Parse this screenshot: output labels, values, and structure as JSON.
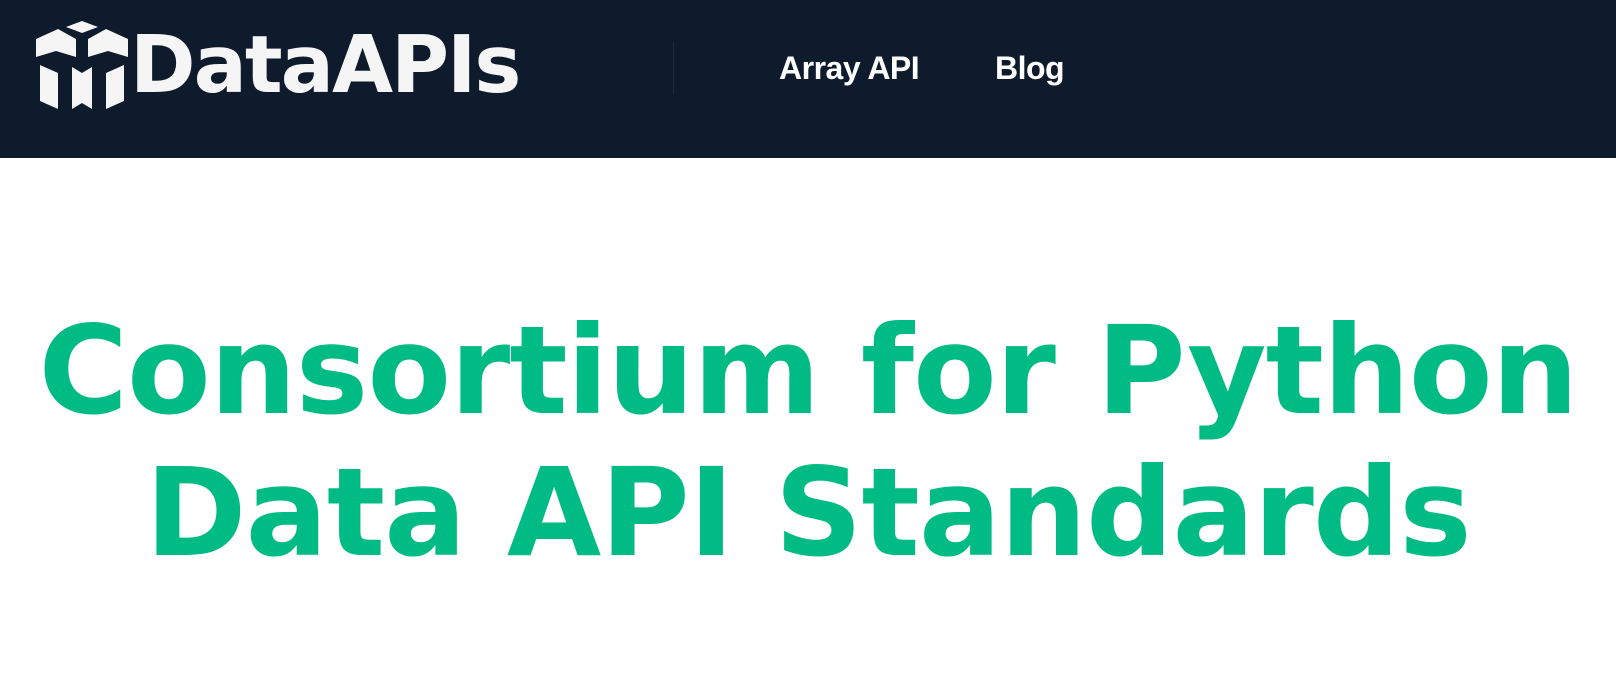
{
  "header": {
    "logo_text": "DataAPIs",
    "logo_icon": "data-apis-logo-icon",
    "nav_items": [
      {
        "label": "Array API"
      },
      {
        "label": "Blog"
      }
    ]
  },
  "hero": {
    "title_line1": "Consortium for Python",
    "title_line2": "Data API Standards"
  },
  "colors": {
    "navbar_bg": "#0e1b2c",
    "hero_text": "#00bb83",
    "nav_text": "#ffffff",
    "logo": "#f5f5f5"
  }
}
